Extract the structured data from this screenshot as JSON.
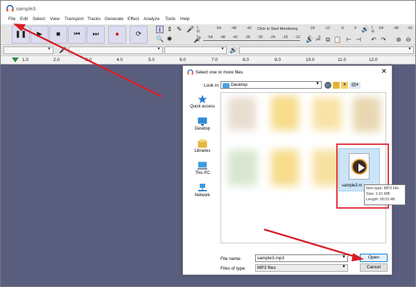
{
  "window": {
    "title": "sample3"
  },
  "menu": [
    "File",
    "Edit",
    "Select",
    "View",
    "Transport",
    "Tracks",
    "Generate",
    "Effect",
    "Analyze",
    "Tools",
    "Help"
  ],
  "meter": {
    "scale_top": [
      "-54",
      "-48",
      "-42",
      "-18",
      "-12",
      "-6",
      "0"
    ],
    "scale_bottom": [
      "-54",
      "-48",
      "-42",
      "-36",
      "-30",
      "-24",
      "-18",
      "-12",
      "-6",
      "0"
    ],
    "monitor_text": "Click to Start Monitoring",
    "channel_l": "L",
    "channel_r": "R"
  },
  "timeline": [
    "1.0",
    "2.0",
    "3.0",
    "4.0",
    "5.0",
    "6.0",
    "7.0",
    "8.0",
    "9.0",
    "10.0",
    "11.0",
    "12.0"
  ],
  "dialog": {
    "title": "Select one or more files",
    "close": "✕",
    "lookin_label": "Look in:",
    "lookin_value": "Desktop",
    "places": [
      "Quick access",
      "Desktop",
      "Libraries",
      "This PC",
      "Network"
    ],
    "selected_file_label": "sample3.m",
    "tooltip": [
      "Item type: MP3 File",
      "Size: 1.61 MB",
      "Length: 00:01:48"
    ],
    "filename_label": "File name:",
    "filename_value": "sample3.mp3",
    "filetype_label": "Files of type:",
    "filetype_value": "MP3 files",
    "open_label": "Open",
    "cancel_label": "Cancel"
  },
  "colors": {
    "track_bg": "#5a5e7e",
    "annotation_red": "#e0313b",
    "selection_blue": "#cce4f7"
  }
}
